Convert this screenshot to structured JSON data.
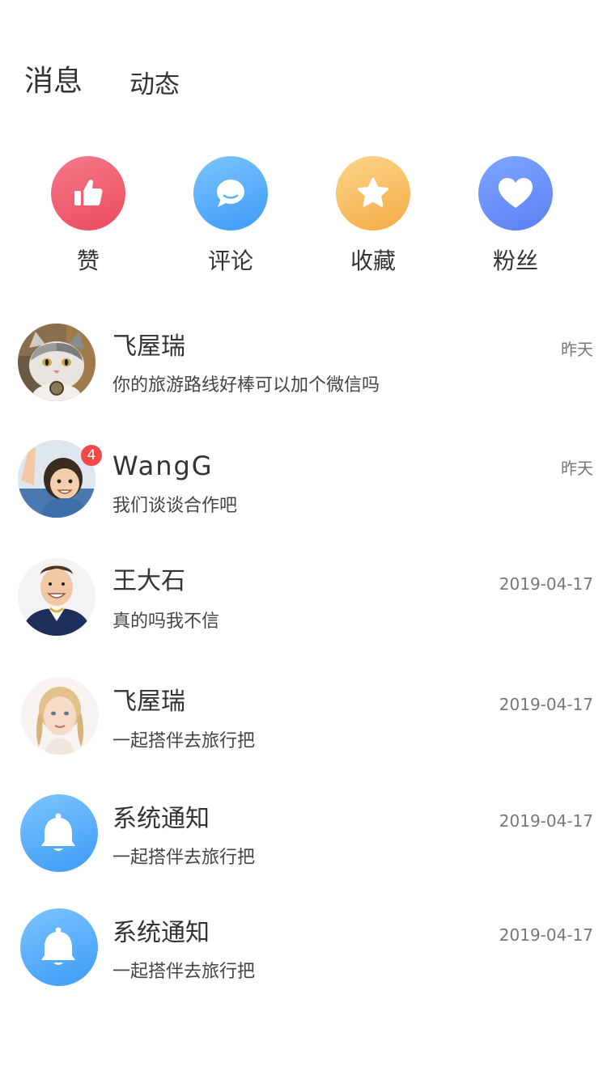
{
  "tabs": {
    "messages": "消息",
    "moments": "动态"
  },
  "quick_entries": [
    {
      "label": "赞",
      "icon": "thumbs-up-icon",
      "color_from": "#f47a8a",
      "color_to": "#ec4a5e"
    },
    {
      "label": "评论",
      "icon": "comment-icon",
      "color_from": "#7cc4ff",
      "color_to": "#3d9bf7"
    },
    {
      "label": "收藏",
      "icon": "star-icon",
      "color_from": "#fbd58a",
      "color_to": "#f4ab45"
    },
    {
      "label": "粉丝",
      "icon": "heart-icon",
      "color_from": "#7ea6ff",
      "color_to": "#5a80f4"
    }
  ],
  "conversations": [
    {
      "name": "飞屋瑞",
      "time": "昨天",
      "preview": "你的旅游路线好棒可以加个微信吗",
      "avatar": "cat-avatar"
    },
    {
      "name": "WangG",
      "time": "昨天",
      "preview": "我们谈谈合作吧",
      "avatar": "child-avatar",
      "badge": "4"
    },
    {
      "name": "王大石",
      "time": "2019-04-17",
      "preview": "真的吗我不信",
      "avatar": "man-avatar"
    },
    {
      "name": "飞屋瑞",
      "time": "2019-04-17",
      "preview": "一起搭伴去旅行把",
      "avatar": "girl-avatar"
    },
    {
      "name": "系统通知",
      "time": "2019-04-17",
      "preview": "一起搭伴去旅行把",
      "avatar": "bell-icon"
    },
    {
      "name": "系统通知",
      "time": "2019-04-17",
      "preview": "一起搭伴去旅行把",
      "avatar": "bell-icon"
    }
  ],
  "colors": {
    "text_primary": "#333333",
    "text_time": "#777777",
    "badge": "#f04848",
    "system_avatar_from": "#7cc4ff",
    "system_avatar_to": "#3d9bf7"
  }
}
